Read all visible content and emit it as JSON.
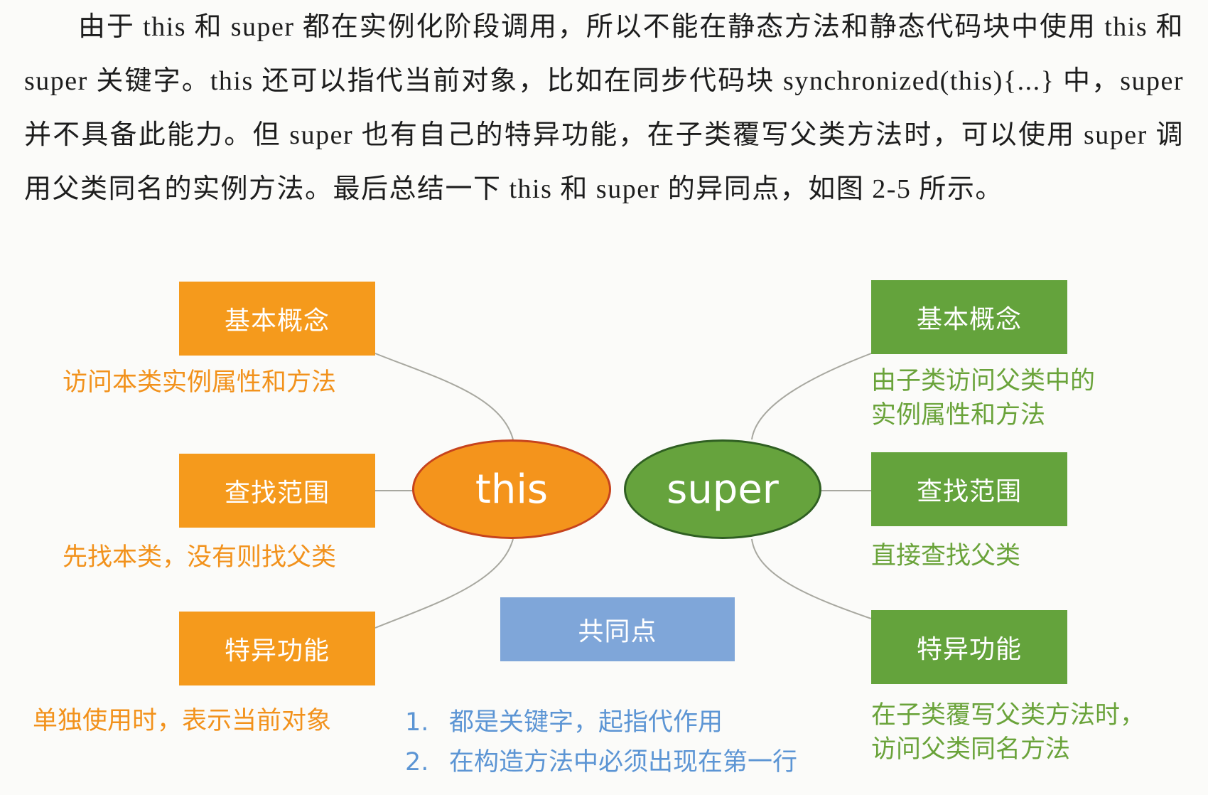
{
  "paragraph": "由于 this 和 super 都在实例化阶段调用，所以不能在静态方法和静态代码块中使用 this 和 super 关键字。this 还可以指代当前对象，比如在同步代码块 synchronized(this){...} 中，super 并不具备此能力。但 super 也有自己的特异功能，在子类覆写父类方法时，可以使用 super 调用父类同名的实例方法。最后总结一下 this 和 super 的异同点，如图 2-5 所示。",
  "diagram": {
    "this": {
      "label": "this",
      "color": "#f4941c",
      "sections": [
        {
          "title": "基本概念",
          "desc": "访问本类实例属性和方法"
        },
        {
          "title": "查找范围",
          "desc": "先找本类，没有则找父类"
        },
        {
          "title": "特异功能",
          "desc": "单独使用时，表示当前对象"
        }
      ]
    },
    "super": {
      "label": "super",
      "color": "#66a33d",
      "sections": [
        {
          "title": "基本概念",
          "desc_lines": [
            "由子类访问父类中的",
            "实例属性和方法"
          ]
        },
        {
          "title": "查找范围",
          "desc_lines": [
            "直接查找父类"
          ]
        },
        {
          "title": "特异功能",
          "desc_lines": [
            "在子类覆写父类方法时，",
            "访问父类同名方法"
          ]
        }
      ]
    },
    "common": {
      "title": "共同点",
      "color": "#7fa6d9",
      "items": [
        {
          "num": "1.",
          "text": "都是关键字，起指代作用"
        },
        {
          "num": "2.",
          "text": "在构造方法中必须出现在第一行"
        }
      ]
    }
  }
}
